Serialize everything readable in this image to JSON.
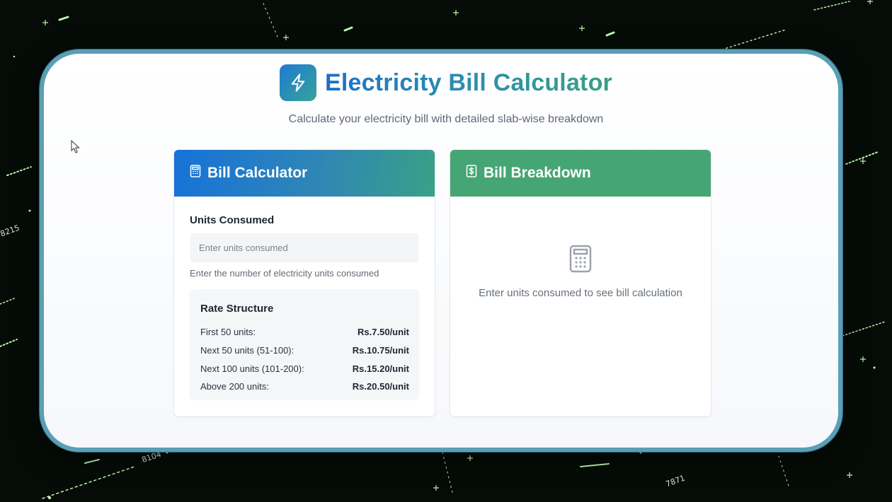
{
  "app": {
    "title": "Electricity Bill Calculator",
    "subtitle": "Calculate your electricity bill with detailed slab-wise breakdown",
    "logo_icon": "lightning-bolt-icon"
  },
  "calculator": {
    "header": "Bill Calculator",
    "header_icon": "calculator-icon",
    "units_label": "Units Consumed",
    "units_value": "",
    "units_placeholder": "Enter units consumed",
    "helper": "Enter the number of electricity units consumed",
    "rate_structure": {
      "title": "Rate Structure",
      "rows": [
        {
          "label": "First 50 units:",
          "rate": "Rs.7.50/unit"
        },
        {
          "label": "Next 50 units (51-100):",
          "rate": "Rs.10.75/unit"
        },
        {
          "label": "Next 100 units (101-200):",
          "rate": "Rs.15.20/unit"
        },
        {
          "label": "Above 200 units:",
          "rate": "Rs.20.50/unit"
        }
      ]
    }
  },
  "breakdown": {
    "header": "Bill Breakdown",
    "header_icon": "receipt-dollar-icon",
    "empty_icon": "calculator-icon",
    "empty_text": "Enter units consumed to see bill calculation"
  },
  "background": {
    "numbers": [
      "8215",
      "8104",
      "7871"
    ]
  },
  "colors": {
    "accent_blue": "#1672d8",
    "accent_teal": "#3aa086",
    "breakdown_green": "#46a574",
    "frame_border": "#5a9fb5"
  }
}
